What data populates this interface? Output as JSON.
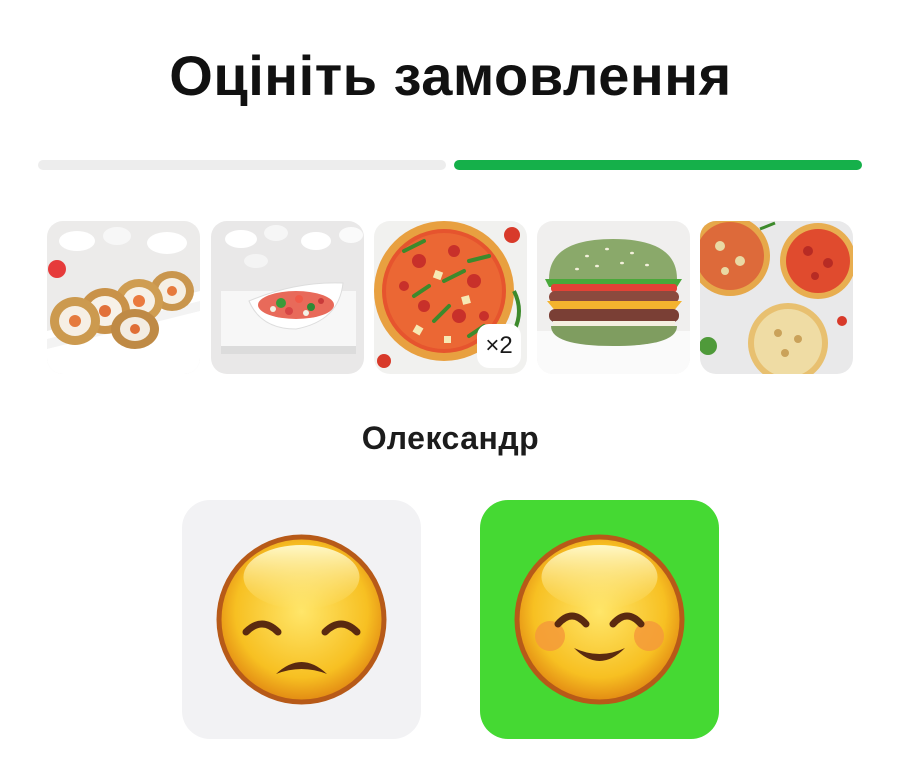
{
  "header": {
    "title": "Оцініть замовлення"
  },
  "progress": {
    "steps_total": 2,
    "current_step": 2,
    "colors": {
      "inactive": "#ededed",
      "active": "#15b04a"
    }
  },
  "order_items": [
    {
      "name": "sushi-roll-image"
    },
    {
      "name": "salad-bowl-image"
    },
    {
      "name": "pizza-image",
      "quantity_badge": "×2"
    },
    {
      "name": "green-bun-burger-image"
    },
    {
      "name": "assorted-pizzas-image"
    }
  ],
  "courier": {
    "name": "Олександр"
  },
  "rating": {
    "options": [
      {
        "value": "bad",
        "icon": "sad-face-icon",
        "background": "#f2f2f4"
      },
      {
        "value": "good",
        "icon": "smiling-face-icon",
        "background": "#45d933",
        "selected": true
      }
    ]
  }
}
